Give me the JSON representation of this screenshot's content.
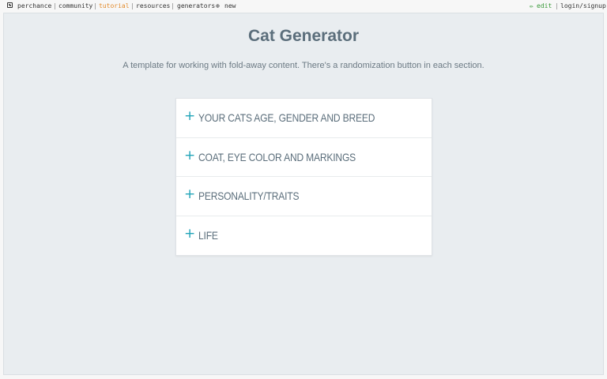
{
  "topbar": {
    "brand": "perchance",
    "community": "community",
    "tutorial": "tutorial",
    "resources": "resources",
    "generators": "generators",
    "new": "new",
    "edit": "edit",
    "login": "login/signup",
    "sep": "|",
    "new_icon": "⊕",
    "edit_icon": "✏"
  },
  "page": {
    "title": "Cat Generator",
    "subtitle": "A template for working with fold-away content. There's a randomization button in each section."
  },
  "sections": [
    {
      "label": "YOUR CATS AGE, GENDER AND BREED",
      "icon": "+"
    },
    {
      "label": "COAT, EYE COLOR AND MARKINGS",
      "icon": "+"
    },
    {
      "label": "PERSONALITY/TRAITS",
      "icon": "+"
    },
    {
      "label": "LIFE",
      "icon": "+"
    }
  ],
  "colors": {
    "accent": "#22a4b8",
    "title": "#5b6e7b",
    "tutorial": "#e28b2c",
    "edit": "#3a9a3a"
  }
}
